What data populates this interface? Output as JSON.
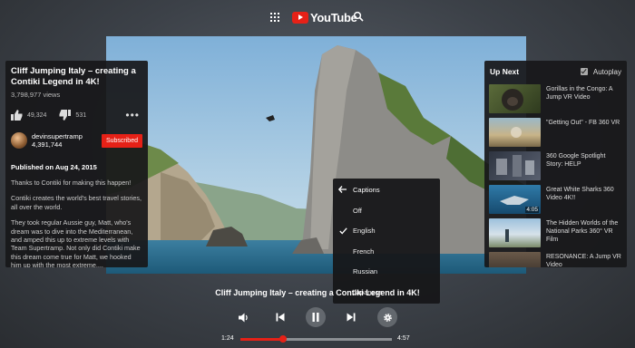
{
  "header": {
    "app_name": "YouTube"
  },
  "video": {
    "title": "Cliff Jumping Italy – creating a Contiki Legend in 4K!",
    "overlay_title": "Cliff Jumping Italy – creating a Contiki Legend in 4K!",
    "views": "3,798,977 views",
    "likes": "49,324",
    "dislikes": "531",
    "channel": "devinsupertramp",
    "subscribers": "4,391,744",
    "subscribe_label": "Subscribed",
    "published": "Published on Aug 24, 2015",
    "description": [
      "Thanks to Contiki for making this happen!",
      "Contiki creates the world's best travel stories, all over the world.",
      "They took regular Aussie guy, Matt, who's dream was to dive into the Mediterranean, and amped this up to extreme levels with Team Supertramp. Not only did Contiki make this dream come true for Matt, we hooked him up with the most extreme...."
    ]
  },
  "up_next": {
    "title": "Up Next",
    "autoplay_label": "Autoplay",
    "autoplay_checked": true,
    "items": [
      {
        "title": "Gorillas in the Congo: A Jump VR Video",
        "duration": ""
      },
      {
        "title": "\"Getting Out\" - FB 360 VR",
        "duration": ""
      },
      {
        "title": "360 Google Spotlight Story: HELP",
        "duration": ""
      },
      {
        "title": "Great White Sharks 360 Video 4K!!",
        "duration": "4:05"
      },
      {
        "title": "The Hidden Worlds of the National Parks 360° VR Film",
        "duration": ""
      },
      {
        "title": "RESONANCE: A Jump VR Video",
        "duration": ""
      }
    ]
  },
  "captions_menu": {
    "title": "Captions",
    "options": [
      "Off",
      "English",
      "French",
      "Russian",
      "Japanese"
    ],
    "selected": "English"
  },
  "player": {
    "current_time": "1:24",
    "duration": "4:57",
    "progress_fraction": 0.283
  },
  "colors": {
    "accent": "#e62117"
  }
}
